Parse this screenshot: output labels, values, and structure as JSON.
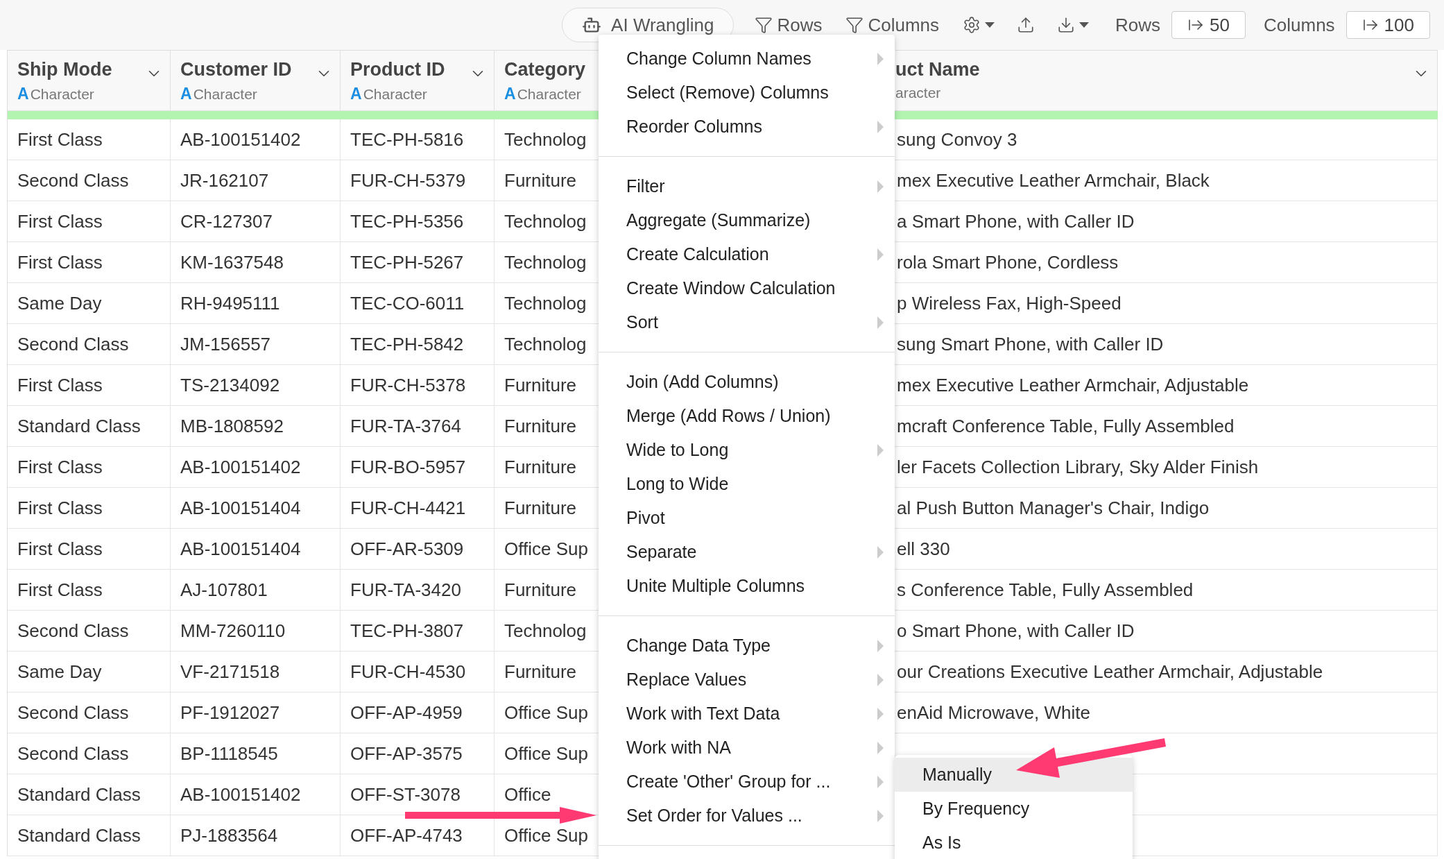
{
  "toolbar": {
    "ai_button": "AI Wrangling",
    "filters": [
      "Rows",
      "Columns"
    ],
    "row_limit": {
      "label": "Rows",
      "value": "50"
    },
    "column_limit": {
      "label": "Columns",
      "value": "100"
    }
  },
  "table": {
    "columns": [
      {
        "name": "Ship Mode",
        "type_icon": "A",
        "type": "Character"
      },
      {
        "name": "Customer ID",
        "type_icon": "A",
        "type": "Character"
      },
      {
        "name": "Product ID",
        "type_icon": "A",
        "type": "Character"
      },
      {
        "name": "Category",
        "type_icon": "A",
        "type": "Character"
      },
      {
        "name": "uct Name",
        "type": "aracter"
      }
    ],
    "rows": [
      {
        "cells": [
          "First Class",
          "AB-100151402",
          "TEC-PH-5816",
          "Technolog",
          "sung Convoy 3"
        ]
      },
      {
        "cells": [
          "Second Class",
          "JR-162107",
          "FUR-CH-5379",
          "Furniture",
          "mex Executive Leather Armchair, Black"
        ]
      },
      {
        "cells": [
          "First Class",
          "CR-127307",
          "TEC-PH-5356",
          "Technolog",
          "a Smart Phone, with Caller ID"
        ]
      },
      {
        "cells": [
          "First Class",
          "KM-1637548",
          "TEC-PH-5267",
          "Technolog",
          "rola Smart Phone, Cordless"
        ]
      },
      {
        "cells": [
          "Same Day",
          "RH-9495111",
          "TEC-CO-6011",
          "Technolog",
          "p Wireless Fax, High-Speed"
        ]
      },
      {
        "cells": [
          "Second Class",
          "JM-156557",
          "TEC-PH-5842",
          "Technolog",
          "sung Smart Phone, with Caller ID"
        ]
      },
      {
        "cells": [
          "First Class",
          "TS-2134092",
          "FUR-CH-5378",
          "Furniture",
          "mex Executive Leather Armchair, Adjustable"
        ]
      },
      {
        "cells": [
          "Standard Class",
          "MB-1808592",
          "FUR-TA-3764",
          "Furniture",
          "mcraft Conference Table, Fully Assembled"
        ]
      },
      {
        "cells": [
          "First Class",
          "AB-100151402",
          "FUR-BO-5957",
          "Furniture",
          "ler Facets Collection Library, Sky Alder Finish"
        ]
      },
      {
        "cells": [
          "First Class",
          "AB-100151404",
          "FUR-CH-4421",
          "Furniture",
          "al Push Button Manager's Chair, Indigo"
        ]
      },
      {
        "cells": [
          "First Class",
          "AB-100151404",
          "OFF-AR-5309",
          "Office Sup",
          "ell 330"
        ]
      },
      {
        "cells": [
          "First Class",
          "AJ-107801",
          "FUR-TA-3420",
          "Furniture",
          "s Conference Table, Fully Assembled"
        ]
      },
      {
        "cells": [
          "Second Class",
          "MM-7260110",
          "TEC-PH-3807",
          "Technolog",
          "o Smart Phone, with Caller ID"
        ]
      },
      {
        "cells": [
          "Same Day",
          "VF-2171518",
          "FUR-CH-4530",
          "Furniture",
          "our Creations Executive Leather Armchair, Adjustable"
        ]
      },
      {
        "cells": [
          "Second Class",
          "PF-1912027",
          "OFF-AP-4959",
          "Office Sup",
          "enAid Microwave, White"
        ]
      },
      {
        "cells": [
          "Second Class",
          "BP-1118545",
          "OFF-AP-3575",
          "Office Sup"
        ]
      },
      {
        "cells": [
          "Standard Class",
          "AB-100151402",
          "OFF-ST-3078",
          "Office"
        ]
      },
      {
        "cells": [
          "Standard Class",
          "PJ-1883564",
          "OFF-AP-4743",
          "Office Sup"
        ]
      }
    ]
  },
  "menu": {
    "groups": [
      [
        {
          "label": "Change Column Names",
          "has_submenu": true
        },
        {
          "label": "Select (Remove) Columns",
          "has_submenu": false
        },
        {
          "label": "Reorder Columns",
          "has_submenu": true
        }
      ],
      [
        {
          "label": "Filter",
          "has_submenu": true
        },
        {
          "label": "Aggregate (Summarize)",
          "has_submenu": false
        },
        {
          "label": "Create Calculation",
          "has_submenu": true
        },
        {
          "label": "Create Window Calculation",
          "has_submenu": false
        },
        {
          "label": "Sort",
          "has_submenu": true
        }
      ],
      [
        {
          "label": "Join (Add Columns)",
          "has_submenu": false
        },
        {
          "label": "Merge (Add Rows / Union)",
          "has_submenu": false
        },
        {
          "label": "Wide to Long",
          "has_submenu": true
        },
        {
          "label": "Long to Wide",
          "has_submenu": false
        },
        {
          "label": "Pivot",
          "has_submenu": false
        },
        {
          "label": "Separate",
          "has_submenu": true
        },
        {
          "label": "Unite Multiple Columns",
          "has_submenu": false
        }
      ],
      [
        {
          "label": "Change Data Type",
          "has_submenu": true
        },
        {
          "label": "Replace Values",
          "has_submenu": true
        },
        {
          "label": "Work with Text Data",
          "has_submenu": true
        },
        {
          "label": "Work with NA",
          "has_submenu": true
        },
        {
          "label": "Create 'Other' Group for ...",
          "has_submenu": true
        },
        {
          "label": "Set Order for Values ...",
          "has_submenu": true
        }
      ]
    ]
  },
  "submenu": {
    "items": [
      {
        "label": "Manually",
        "selected": true
      },
      {
        "label": "By Frequency",
        "selected": false
      },
      {
        "label": "As Is",
        "selected": false
      }
    ]
  }
}
